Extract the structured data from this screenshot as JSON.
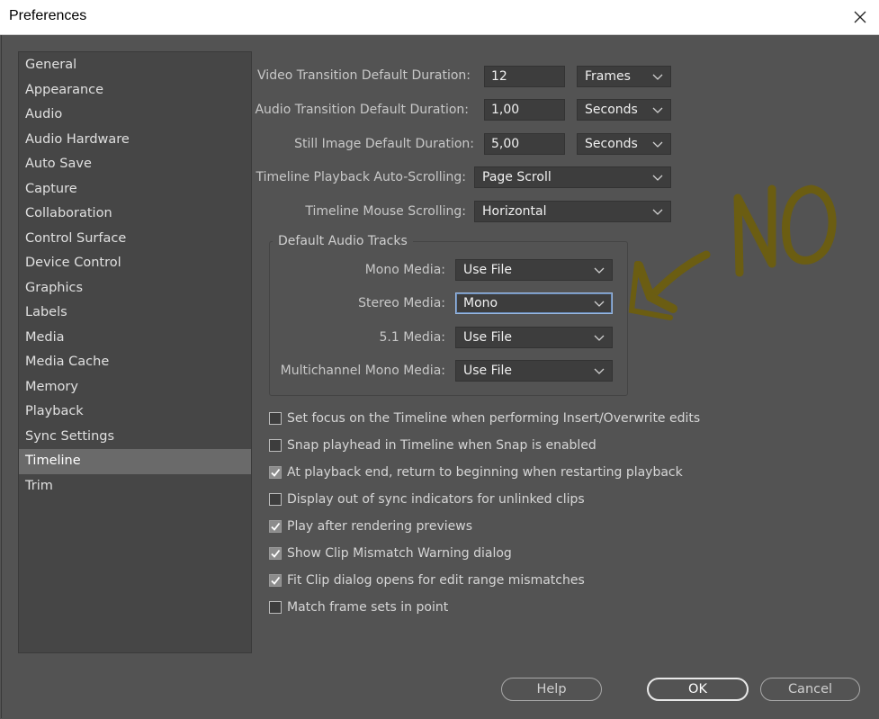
{
  "window": {
    "title": "Preferences"
  },
  "sidebar": {
    "items": [
      {
        "label": "General"
      },
      {
        "label": "Appearance"
      },
      {
        "label": "Audio"
      },
      {
        "label": "Audio Hardware"
      },
      {
        "label": "Auto Save"
      },
      {
        "label": "Capture"
      },
      {
        "label": "Collaboration"
      },
      {
        "label": "Control Surface"
      },
      {
        "label": "Device Control"
      },
      {
        "label": "Graphics"
      },
      {
        "label": "Labels"
      },
      {
        "label": "Media"
      },
      {
        "label": "Media Cache"
      },
      {
        "label": "Memory"
      },
      {
        "label": "Playback"
      },
      {
        "label": "Sync Settings"
      },
      {
        "label": "Timeline"
      },
      {
        "label": "Trim"
      }
    ],
    "active": "Timeline"
  },
  "settings": {
    "video_transition": {
      "label": "Video Transition Default Duration:",
      "value": "12",
      "unit": "Frames"
    },
    "audio_transition": {
      "label": "Audio Transition Default Duration:",
      "value": "1,00",
      "unit": "Seconds"
    },
    "still_image": {
      "label": "Still Image Default Duration:",
      "value": "5,00",
      "unit": "Seconds"
    },
    "playback_scroll": {
      "label": "Timeline Playback Auto-Scrolling:",
      "value": "Page Scroll"
    },
    "mouse_scroll": {
      "label": "Timeline Mouse Scrolling:",
      "value": "Horizontal"
    }
  },
  "audio_tracks": {
    "title": "Default Audio Tracks",
    "mono": {
      "label": "Mono Media:",
      "value": "Use File"
    },
    "stereo": {
      "label": "Stereo Media:",
      "value": "Mono"
    },
    "five_one": {
      "label": "5.1 Media:",
      "value": "Use File"
    },
    "multichannel": {
      "label": "Multichannel Mono Media:",
      "value": "Use File"
    }
  },
  "checkboxes": [
    {
      "label": "Set focus on the Timeline when performing Insert/Overwrite edits",
      "checked": false
    },
    {
      "label": "Snap playhead in Timeline when Snap is enabled",
      "checked": false
    },
    {
      "label": "At playback end, return to beginning when restarting playback",
      "checked": true
    },
    {
      "label": "Display out of sync indicators for unlinked clips",
      "checked": false
    },
    {
      "label": "Play after rendering previews",
      "checked": true
    },
    {
      "label": "Show Clip Mismatch Warning dialog",
      "checked": true
    },
    {
      "label": "Fit Clip dialog opens for edit range mismatches",
      "checked": true
    },
    {
      "label": "Match frame sets in point",
      "checked": false
    }
  ],
  "buttons": {
    "help": "Help",
    "ok": "OK",
    "cancel": "Cancel"
  },
  "annotation": {
    "text": "NO",
    "color": "#6b5d12"
  },
  "icons": {
    "close": "close-icon",
    "chevron": "chevron-down-icon",
    "check": "checkmark-icon"
  }
}
